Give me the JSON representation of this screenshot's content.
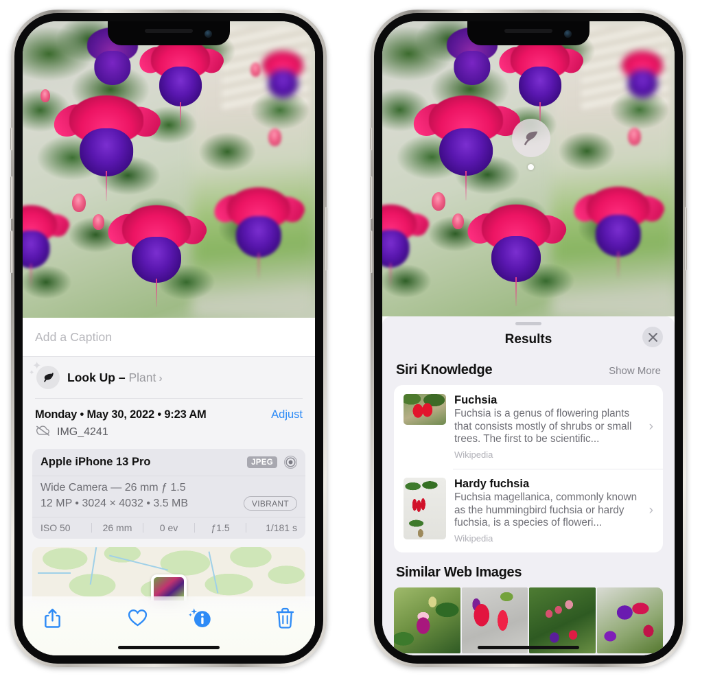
{
  "left_phone": {
    "name": "iphone-photos-info",
    "caption": {
      "placeholder": "Add a Caption",
      "value": ""
    },
    "look_up": {
      "label": "Look Up",
      "dash": "–",
      "subject": "Plant",
      "chevron": "›",
      "icon": "leaf-icon"
    },
    "meta": {
      "date": "Monday • May 30, 2022 • 9:23 AM",
      "adjust": "Adjust",
      "filename": "IMG_4241",
      "cloud_icon": "cloud-slash-icon"
    },
    "camera": {
      "device": "Apple iPhone 13 Pro",
      "format_badge": "JPEG",
      "lens_icon": "aperture-icon",
      "lens_line": "Wide Camera — 26 mm ƒ 1.5",
      "spec_line": "12 MP • 3024 × 4032 • 3.5 MB",
      "style_badge": "VIBRANT",
      "exif": [
        "ISO 50",
        "26 mm",
        "0 ev",
        "ƒ1.5",
        "1/181 s"
      ]
    },
    "toolbar": [
      {
        "name": "share-button",
        "icon": "share-icon"
      },
      {
        "name": "favorite-button",
        "icon": "heart-icon"
      },
      {
        "name": "info-button",
        "icon": "info-sparkle-icon"
      },
      {
        "name": "delete-button",
        "icon": "trash-icon"
      }
    ]
  },
  "right_phone": {
    "name": "iphone-visual-lookup-results",
    "badge": {
      "icon": "leaf-icon"
    },
    "sheet": {
      "title": "Results",
      "close_icon": "close-icon"
    },
    "siri_knowledge": {
      "title": "Siri Knowledge",
      "action": "Show More",
      "items": [
        {
          "title": "Fuchsia",
          "description": "Fuchsia is a genus of flowering plants that consists mostly of shrubs or small trees. The first to be scientific...",
          "source": "Wikipedia",
          "thumb": "fuchsia-thumbnail",
          "chevron": "›"
        },
        {
          "title": "Hardy fuchsia",
          "description": "Fuchsia magellanica, commonly known as the hummingbird fuchsia or hardy fuchsia, is a species of floweri...",
          "source": "Wikipedia",
          "thumb": "hardy-fuchsia-thumbnail",
          "chevron": "›"
        }
      ]
    },
    "similar_web_images": {
      "title": "Similar Web Images",
      "items": [
        "web-image-1",
        "web-image-2",
        "web-image-3",
        "web-image-4"
      ]
    }
  },
  "colors": {
    "accent_blue": "#2e8bf6",
    "sheet_bg": "#f0eff4",
    "info_bg": "#f4f4f6",
    "card_bg": "#e7e7ec",
    "white": "#ffffff",
    "secondary_text": "#6f6f76",
    "tertiary_text": "#b0b0b7"
  }
}
